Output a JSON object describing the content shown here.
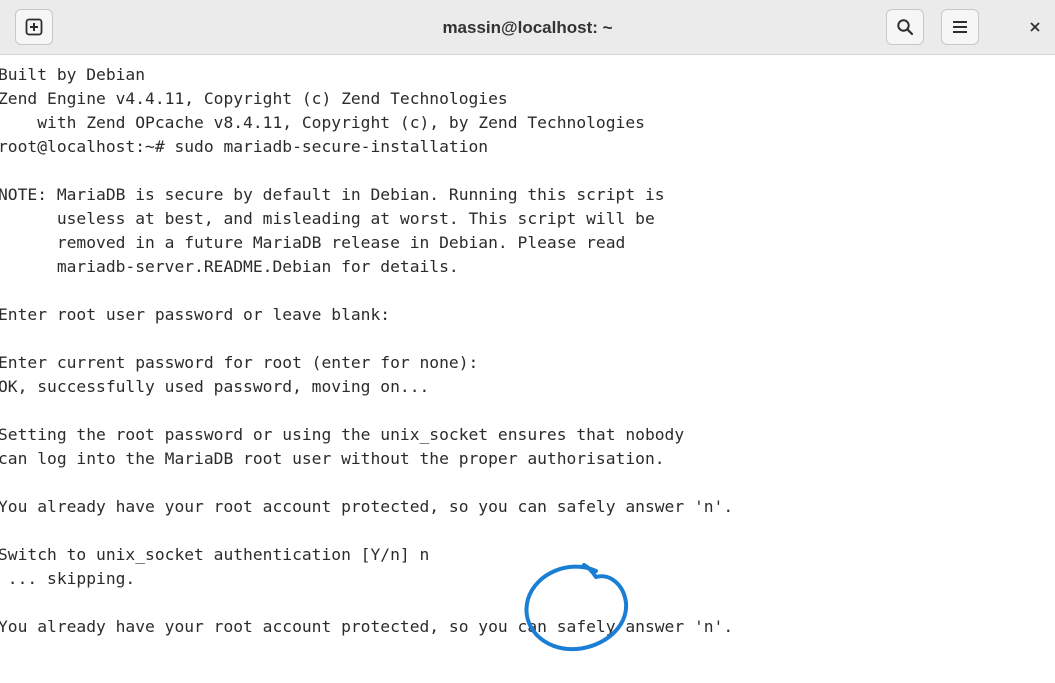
{
  "window": {
    "title": "massin@localhost: ~",
    "icons": {
      "new_tab": "plus-in-square-icon",
      "search": "search-icon",
      "menu": "hamburger-menu-icon",
      "close": "close-icon"
    }
  },
  "terminal": {
    "lines": [
      "Built by Debian",
      "Zend Engine v4.4.11, Copyright (c) Zend Technologies",
      "    with Zend OPcache v8.4.11, Copyright (c), by Zend Technologies",
      "root@localhost:~# sudo mariadb-secure-installation",
      "",
      "NOTE: MariaDB is secure by default in Debian. Running this script is",
      "      useless at best, and misleading at worst. This script will be",
      "      removed in a future MariaDB release in Debian. Please read",
      "      mariadb-server.README.Debian for details.",
      "",
      "Enter root user password or leave blank:",
      "",
      "Enter current password for root (enter for none):",
      "OK, successfully used password, moving on...",
      "",
      "Setting the root password or using the unix_socket ensures that nobody",
      "can log into the MariaDB root user without the proper authorisation.",
      "",
      "You already have your root account protected, so you can safely answer 'n'.",
      "",
      "Switch to unix_socket authentication [Y/n] n",
      " ... skipping.",
      "",
      "You already have your root account protected, so you can safely answer 'n'."
    ]
  },
  "annotation": {
    "shape": "hand-drawn-circle",
    "color": "#1a7fd4"
  }
}
